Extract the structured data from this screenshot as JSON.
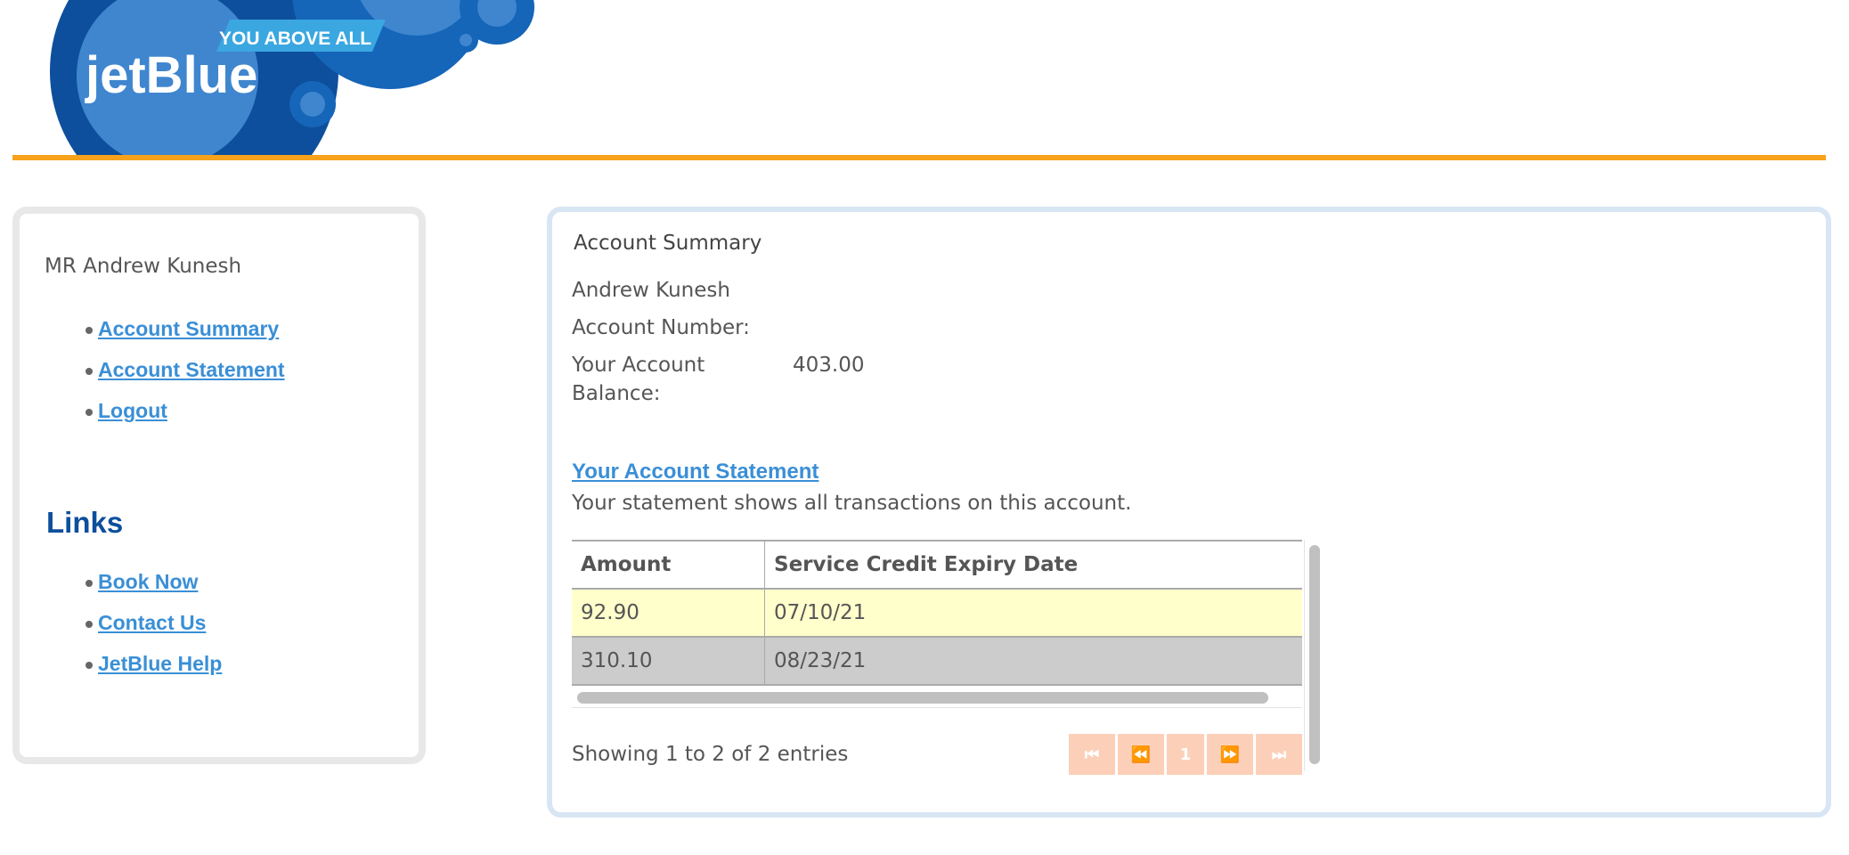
{
  "header": {
    "logo_text": "jetBlue",
    "logo_tagline": "YOU ABOVE ALL",
    "colors": {
      "navy": "#0d4f9c",
      "accent_orange": "#f7a21b",
      "light_blue": "#3aa7e0"
    }
  },
  "sidebar": {
    "user_name": "MR Andrew Kunesh",
    "account_nav": [
      {
        "label": "Account Summary"
      },
      {
        "label": "Account Statement"
      },
      {
        "label": "Logout"
      }
    ],
    "links_heading": "Links",
    "links": [
      {
        "label": "Book Now"
      },
      {
        "label": "Contact Us"
      },
      {
        "label": "JetBlue Help"
      }
    ]
  },
  "main": {
    "title": "Account Summary",
    "holder_name": "Andrew Kunesh",
    "account_number_label": "Account Number:",
    "balance_label": "Your Account Balance:",
    "balance_value": "403.00",
    "statement_link": "Your Account Statement",
    "statement_desc": "Your statement shows all transactions on this account.",
    "table": {
      "headers": [
        "Amount",
        "Service Credit Expiry Date"
      ],
      "rows": [
        {
          "amount": "92.90",
          "expiry": "07/10/21"
        },
        {
          "amount": "310.10",
          "expiry": "08/23/21"
        }
      ]
    },
    "entries_info": "Showing 1 to 2 of 2 entries",
    "pager": {
      "first": "⏮",
      "prev": "⏪",
      "current": "1",
      "next": "⏩",
      "last": "⏭"
    }
  }
}
